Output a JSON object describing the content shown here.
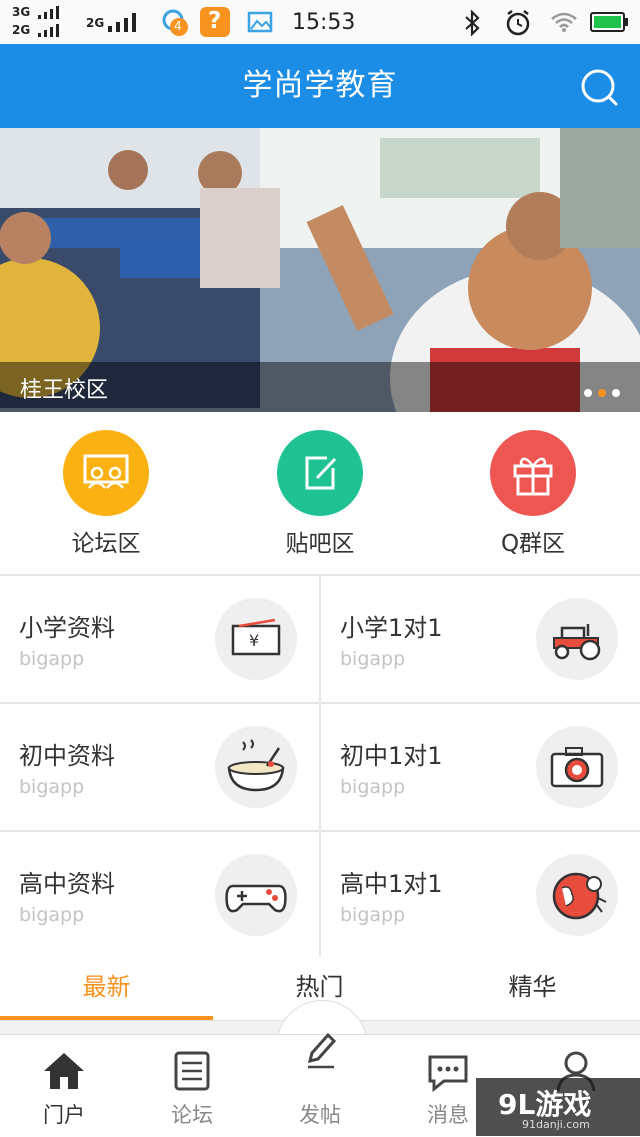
{
  "status_bar": {
    "network_1": "3G",
    "network_2": "2G",
    "network_3": "2G",
    "notification_count": "4",
    "help_icon_text": "?",
    "time": "15:53"
  },
  "header": {
    "title": "学尚学教育",
    "search_icon": "search-icon"
  },
  "banner": {
    "caption": "桂王校区",
    "dots_total": 3,
    "active_dot": 2
  },
  "quick_links": [
    {
      "label": "论坛区",
      "icon": "presentation-icon",
      "color": "#fbb111"
    },
    {
      "label": "贴吧区",
      "icon": "edit-icon",
      "color": "#1ec293"
    },
    {
      "label": "Q群区",
      "icon": "gift-icon",
      "color": "#ee5652"
    }
  ],
  "grid": [
    {
      "title": "小学资料",
      "subtitle": "bigapp",
      "icon": "ticket-yen-icon"
    },
    {
      "title": "小学1对1",
      "subtitle": "bigapp",
      "icon": "tractor-icon"
    },
    {
      "title": "初中资料",
      "subtitle": "bigapp",
      "icon": "bowl-icon"
    },
    {
      "title": "初中1对1",
      "subtitle": "bigapp",
      "icon": "camera-icon"
    },
    {
      "title": "高中资料",
      "subtitle": "bigapp",
      "icon": "gamepad-icon"
    },
    {
      "title": "高中1对1",
      "subtitle": "bigapp",
      "icon": "globe-icon"
    }
  ],
  "tabs": [
    {
      "label": "最新",
      "active": true
    },
    {
      "label": "热门",
      "active": false
    },
    {
      "label": "精华",
      "active": false
    }
  ],
  "bottom_nav": [
    {
      "label": "门户",
      "icon": "home-icon",
      "active": true
    },
    {
      "label": "论坛",
      "icon": "scroll-icon",
      "active": false
    },
    {
      "label": "发帖",
      "icon": "pen-icon",
      "active": false
    },
    {
      "label": "消息",
      "icon": "chat-icon",
      "active": false
    },
    {
      "label": "",
      "icon": "user-icon",
      "active": false
    }
  ],
  "watermark": {
    "main": "9L游戏",
    "sub": "91danji.com"
  },
  "colors": {
    "header_bg": "#1b8de6",
    "accent": "#f7931e"
  }
}
